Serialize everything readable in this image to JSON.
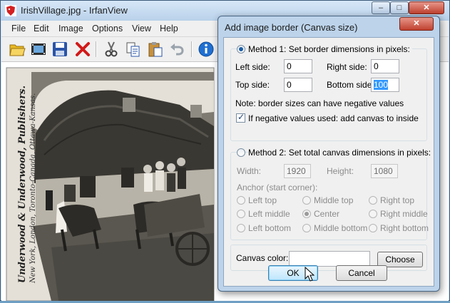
{
  "window": {
    "title": "IrfanView",
    "filename": "IrishVillage.jpg",
    "separator": " - ",
    "controls": {
      "minimize": "–",
      "maximize": "□",
      "close": "✕"
    }
  },
  "menu": [
    "File",
    "Edit",
    "Image",
    "Options",
    "View",
    "Help"
  ],
  "toolbar_icons": [
    "open-folder-icon",
    "slideshow-icon",
    "save-icon",
    "delete-icon",
    "cut-icon",
    "copy-icon",
    "paste-icon",
    "undo-icon",
    "info-icon"
  ],
  "photo": {
    "caption_main": "Underwood & Underwood, Publishers.",
    "caption_cities": "New York,  London,  Toronto-Canada,  Ottawa-Kansas."
  },
  "dialog": {
    "title": "Add image border (Canvas size)",
    "close": "✕",
    "method1": {
      "label": "Method 1: Set border dimensions in pixels:",
      "selected": true,
      "left_label": "Left side:",
      "left_value": "0",
      "right_label": "Right side:",
      "right_value": "0",
      "top_label": "Top side:",
      "top_value": "0",
      "bottom_label": "Bottom side:",
      "bottom_value": "100",
      "note": "Note: border sizes can have negative values",
      "checkbox_label": "If negative values used: add canvas to inside",
      "checkbox_checked": true
    },
    "method2": {
      "label": "Method 2: Set total canvas dimensions in pixels:",
      "selected": false,
      "width_label": "Width:",
      "width_value": "1920",
      "height_label": "Height:",
      "height_value": "1080",
      "anchor_label": "Anchor (start corner):",
      "anchors": [
        "Left top",
        "Middle top",
        "Right top",
        "Left middle",
        "Center",
        "Right middle",
        "Left bottom",
        "Middle bottom",
        "Right bottom"
      ],
      "anchor_selected": "Center"
    },
    "canvas_color_label": "Canvas color:",
    "canvas_color_value": "",
    "choose_label": "Choose",
    "ok_label": "OK",
    "cancel_label": "Cancel"
  },
  "colors": {
    "accent": "#3399ff",
    "title_close": "#c0412f"
  }
}
